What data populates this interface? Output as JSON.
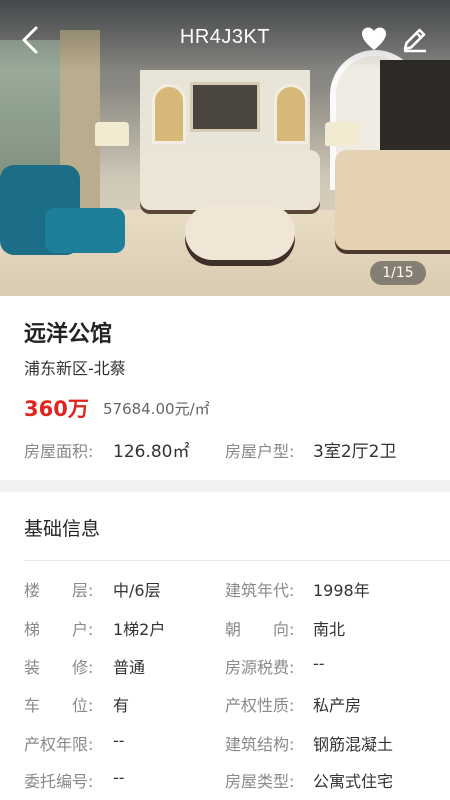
{
  "header": {
    "title": "HR4J3KT",
    "back_icon": "chevron-left-icon",
    "favorite_icon": "heart-icon",
    "edit_icon": "pencil-icon",
    "photo_counter": "1/15"
  },
  "property": {
    "name": "远洋公馆",
    "district": "浦东新区-北蔡",
    "price": "360万",
    "unit_price": "57684.00元/㎡",
    "area_label": "房屋面积:",
    "area_value": "126.80㎡",
    "layout_label": "房屋户型:",
    "layout_value": "3室2厅2卫"
  },
  "basic_info": {
    "title": "基础信息",
    "rows": [
      {
        "l_label": "楼　　层:",
        "l_value": "中/6层",
        "r_label": "建筑年代:",
        "r_value": "1998年"
      },
      {
        "l_label": "梯　　户:",
        "l_value": "1梯2户",
        "r_label": "朝　　向:",
        "r_value": "南北"
      },
      {
        "l_label": "装　　修:",
        "l_value": "普通",
        "r_label": "房源税费:",
        "r_value": "--"
      },
      {
        "l_label": "车　　位:",
        "l_value": "有",
        "r_label": "产权性质:",
        "r_value": "私产房"
      },
      {
        "l_label": "产权年限:",
        "l_value": "--",
        "r_label": "建筑结构:",
        "r_value": "钢筋混凝土"
      },
      {
        "l_label": "委托编号:",
        "l_value": "--",
        "r_label": "房屋类型:",
        "r_value": "公寓式住宅"
      }
    ]
  },
  "colors": {
    "price_red": "#e0251f",
    "label_gray": "#8a8a8a",
    "band_gray": "#f1f1f1"
  }
}
